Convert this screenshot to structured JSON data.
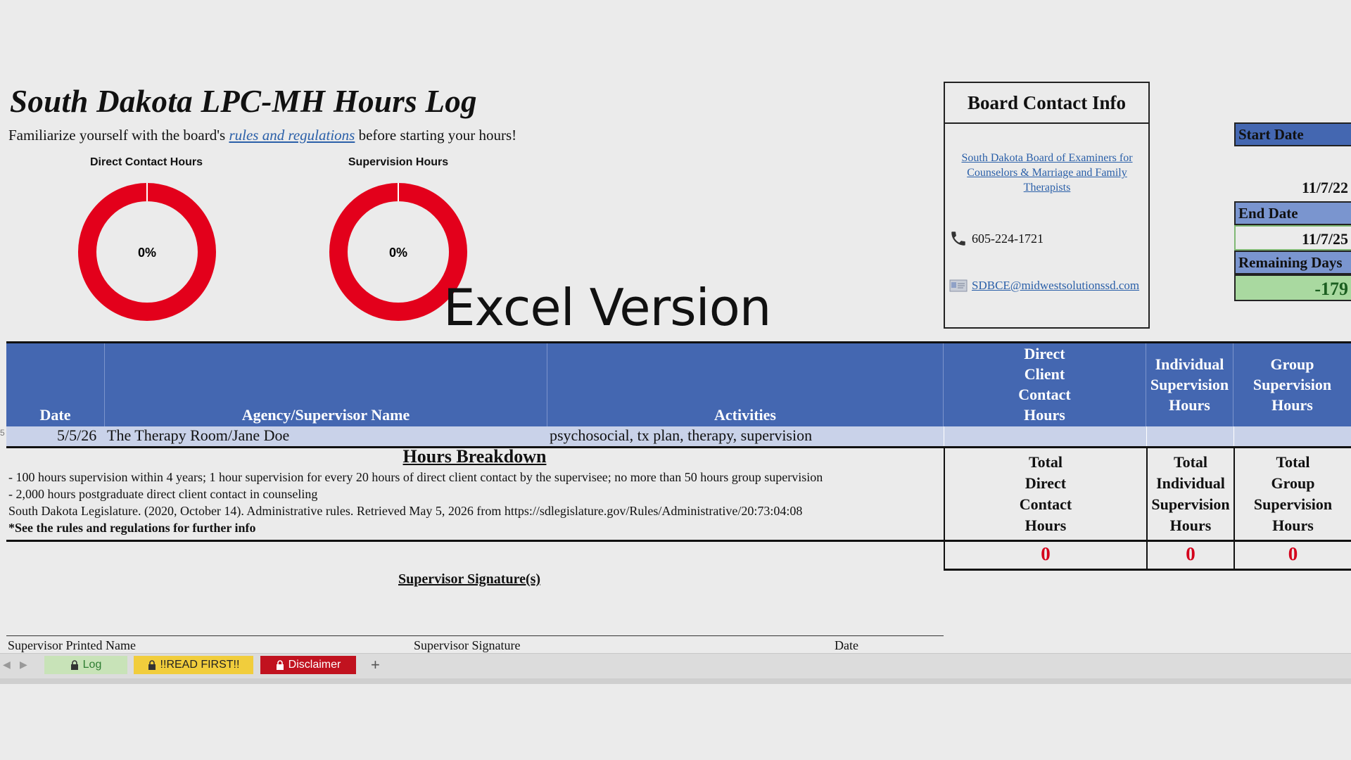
{
  "sheet": {
    "title": "South Dakota LPC-MH Hours Log",
    "subtitle_before": "Familiarize yourself with the board's",
    "subtitle_link": "rules and regulations",
    "subtitle_after": "before starting your hours!",
    "overlay_text": "Excel Version"
  },
  "gauges": [
    {
      "title": "Direct Contact Hours",
      "percent_text": "0%",
      "percent": 0,
      "color": "#e3001b"
    },
    {
      "title": "Supervision Hours",
      "percent_text": "0%",
      "percent": 0,
      "color": "#e3001b"
    }
  ],
  "board": {
    "title": "Board Contact Info",
    "link": "South Dakota Board of Examiners for Counselors & Marriage and Family Therapists",
    "phone_icon": "phone-icon",
    "phone": "605-224-1721",
    "email_icon": "email-icon",
    "email": "SDBCE@midwestsolutionssd.com"
  },
  "dates": {
    "start_label": "Start Date",
    "start_value": "11/7/22",
    "end_label": "End Date",
    "end_value": "11/7/25",
    "remaining_label": "Remaining Days",
    "remaining_value": "-179",
    "remaining_bg": "#a9d9a0"
  },
  "table": {
    "headers": {
      "date": "Date",
      "agency": "Agency/Supervisor Name",
      "activities": "Activities",
      "direct": [
        "Direct",
        "Client",
        "Contact",
        "Hours"
      ],
      "individual": [
        "Individual",
        "Supervision",
        "Hours"
      ],
      "group": [
        "Group",
        "Supervision",
        "Hours"
      ]
    },
    "row": {
      "date": "5/5/26",
      "agency": "The Therapy Room/Jane Doe",
      "activities": "psychosocial, tx plan, therapy, supervision"
    },
    "header_color": "#4467b1"
  },
  "breakdown": {
    "title": "Hours Breakdown",
    "lines": [
      "- 100 hours supervision within 4 years; 1 hour supervision for every 20 hours of direct client contact by the supervisee; no more than 50 hours group supervision",
      "- 2,000 hours postgraduate direct client contact in counseling",
      "South Dakota Legislature. (2020, October 14). Administrative rules. Retrieved May 5, 2026 from https://sdlegislature.gov/Rules/Administrative/20:73:04:08",
      "*See the rules and regulations for further info"
    ]
  },
  "totals": {
    "direct_label": [
      "Total",
      "Direct",
      "Contact",
      "Hours"
    ],
    "individual_label": [
      "Total",
      "Individual",
      "Supervision",
      "Hours"
    ],
    "group_label": [
      "Total",
      "Group",
      "Supervision",
      "Hours"
    ],
    "direct_value": "0",
    "individual_value": "0",
    "group_value": "0"
  },
  "signature": {
    "title": "Supervisor Signature(s)",
    "printed_name": "Supervisor Printed Name",
    "signature": "Supervisor Signature",
    "date": "Date"
  },
  "tabs": [
    {
      "label": "Log",
      "icon": "lock-icon",
      "bg": "#c8e3b8"
    },
    {
      "label": "!!READ FIRST!!",
      "icon": "lock-icon",
      "bg": "#f1cd3c"
    },
    {
      "label": "Disclaimer",
      "icon": "lock-icon",
      "bg": "#c1121f"
    }
  ],
  "add_sheet": "+"
}
